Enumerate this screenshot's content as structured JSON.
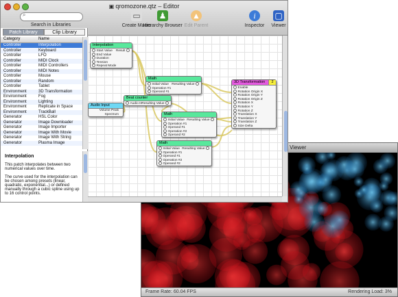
{
  "editor": {
    "title": "qromozone.qtz – Editor",
    "toolbar": {
      "search_label": "Search in Libraries",
      "create_macro": "Create Macro",
      "hierarchy_browser": "Hierarchy Browser",
      "edit_parent": "Edit Parent",
      "inspector": "Inspector",
      "viewer": "Viewer"
    },
    "tabs": [
      "Patch Library",
      "Clip Library"
    ],
    "columns": [
      "Category",
      "Name"
    ],
    "library": [
      [
        "Controller",
        "Interpolation"
      ],
      [
        "Controller",
        "Keyboard"
      ],
      [
        "Controller",
        "LFO"
      ],
      [
        "Controller",
        "MIDI Clock"
      ],
      [
        "Controller",
        "MIDI Controllers"
      ],
      [
        "Controller",
        "MIDI Notes"
      ],
      [
        "Controller",
        "Mouse"
      ],
      [
        "Controller",
        "Random"
      ],
      [
        "Controller",
        "Tablet"
      ],
      [
        "Environment",
        "3D Transformation"
      ],
      [
        "Environment",
        "Fog"
      ],
      [
        "Environment",
        "Lighting"
      ],
      [
        "Environment",
        "Replicate in Space"
      ],
      [
        "Environment",
        "TrackBall"
      ],
      [
        "Generator",
        "HSL Color"
      ],
      [
        "Generator",
        "Image Downloader"
      ],
      [
        "Generator",
        "Image Importer"
      ],
      [
        "Generator",
        "Image With Movie"
      ],
      [
        "Generator",
        "Image With String"
      ],
      [
        "Generator",
        "Plasma Image"
      ]
    ],
    "description": {
      "title": "Interpolation",
      "text": "This patch interpolates between two numerical values over time.",
      "text2": "The curve used for the interpolation can be chosen among presets (linear, quadratic, exponential...) or defined manually through a cubic spline using up to 16 control points."
    },
    "patches": {
      "interpolation": {
        "title": "Interpolation",
        "inputs": [
          "Start Value",
          "End Value",
          "Duration",
          "Tension",
          "Repeat Mode"
        ],
        "output": "Result"
      },
      "math1": {
        "title": "Math",
        "inputs": [
          "Initial Value",
          "Operation #1",
          "Operand #1"
        ],
        "output": "Resulting Value"
      },
      "beat": {
        "title": "Beat counter",
        "inputs": [
          "Audio In"
        ],
        "output": "Resulting Value"
      },
      "audio": {
        "title": "Audio Input",
        "outputs": [
          "Volume Peak",
          "Spectrum"
        ]
      },
      "math2": {
        "title": "Math",
        "inputs": [
          "Initial Value",
          "Operation #1",
          "Operand #1",
          "Operation #2",
          "Operand #2"
        ],
        "output": "Resulting Value"
      },
      "math3": {
        "title": "Math",
        "inputs": [
          "Initial Value",
          "Operation #1",
          "Operand #1",
          "Operation #2",
          "Operand #2"
        ],
        "output": "Resulting Value"
      },
      "transform": {
        "title": "3D Transformation",
        "badge": "2",
        "inputs": [
          "Enable",
          "Rotation Origin X",
          "Rotation Origin Y",
          "Rotation Origin Z",
          "Rotation X",
          "Rotation Y",
          "Rotation Z",
          "Translation X",
          "Translation Y",
          "Translation Z",
          "Size Delta"
        ]
      }
    }
  },
  "viewer": {
    "title": "Viewer",
    "frame_rate": "Frame Rate: 60.04 FPS",
    "rendering_load": "Rendering Load: 3%"
  },
  "colors": {
    "accent": "#3d7bd8",
    "patch_generator": "#58e89c",
    "patch_audio": "#6ed8f4",
    "patch_transform": "#e45adf",
    "badge": "#f7ef3c",
    "wire": "#d9c860"
  }
}
